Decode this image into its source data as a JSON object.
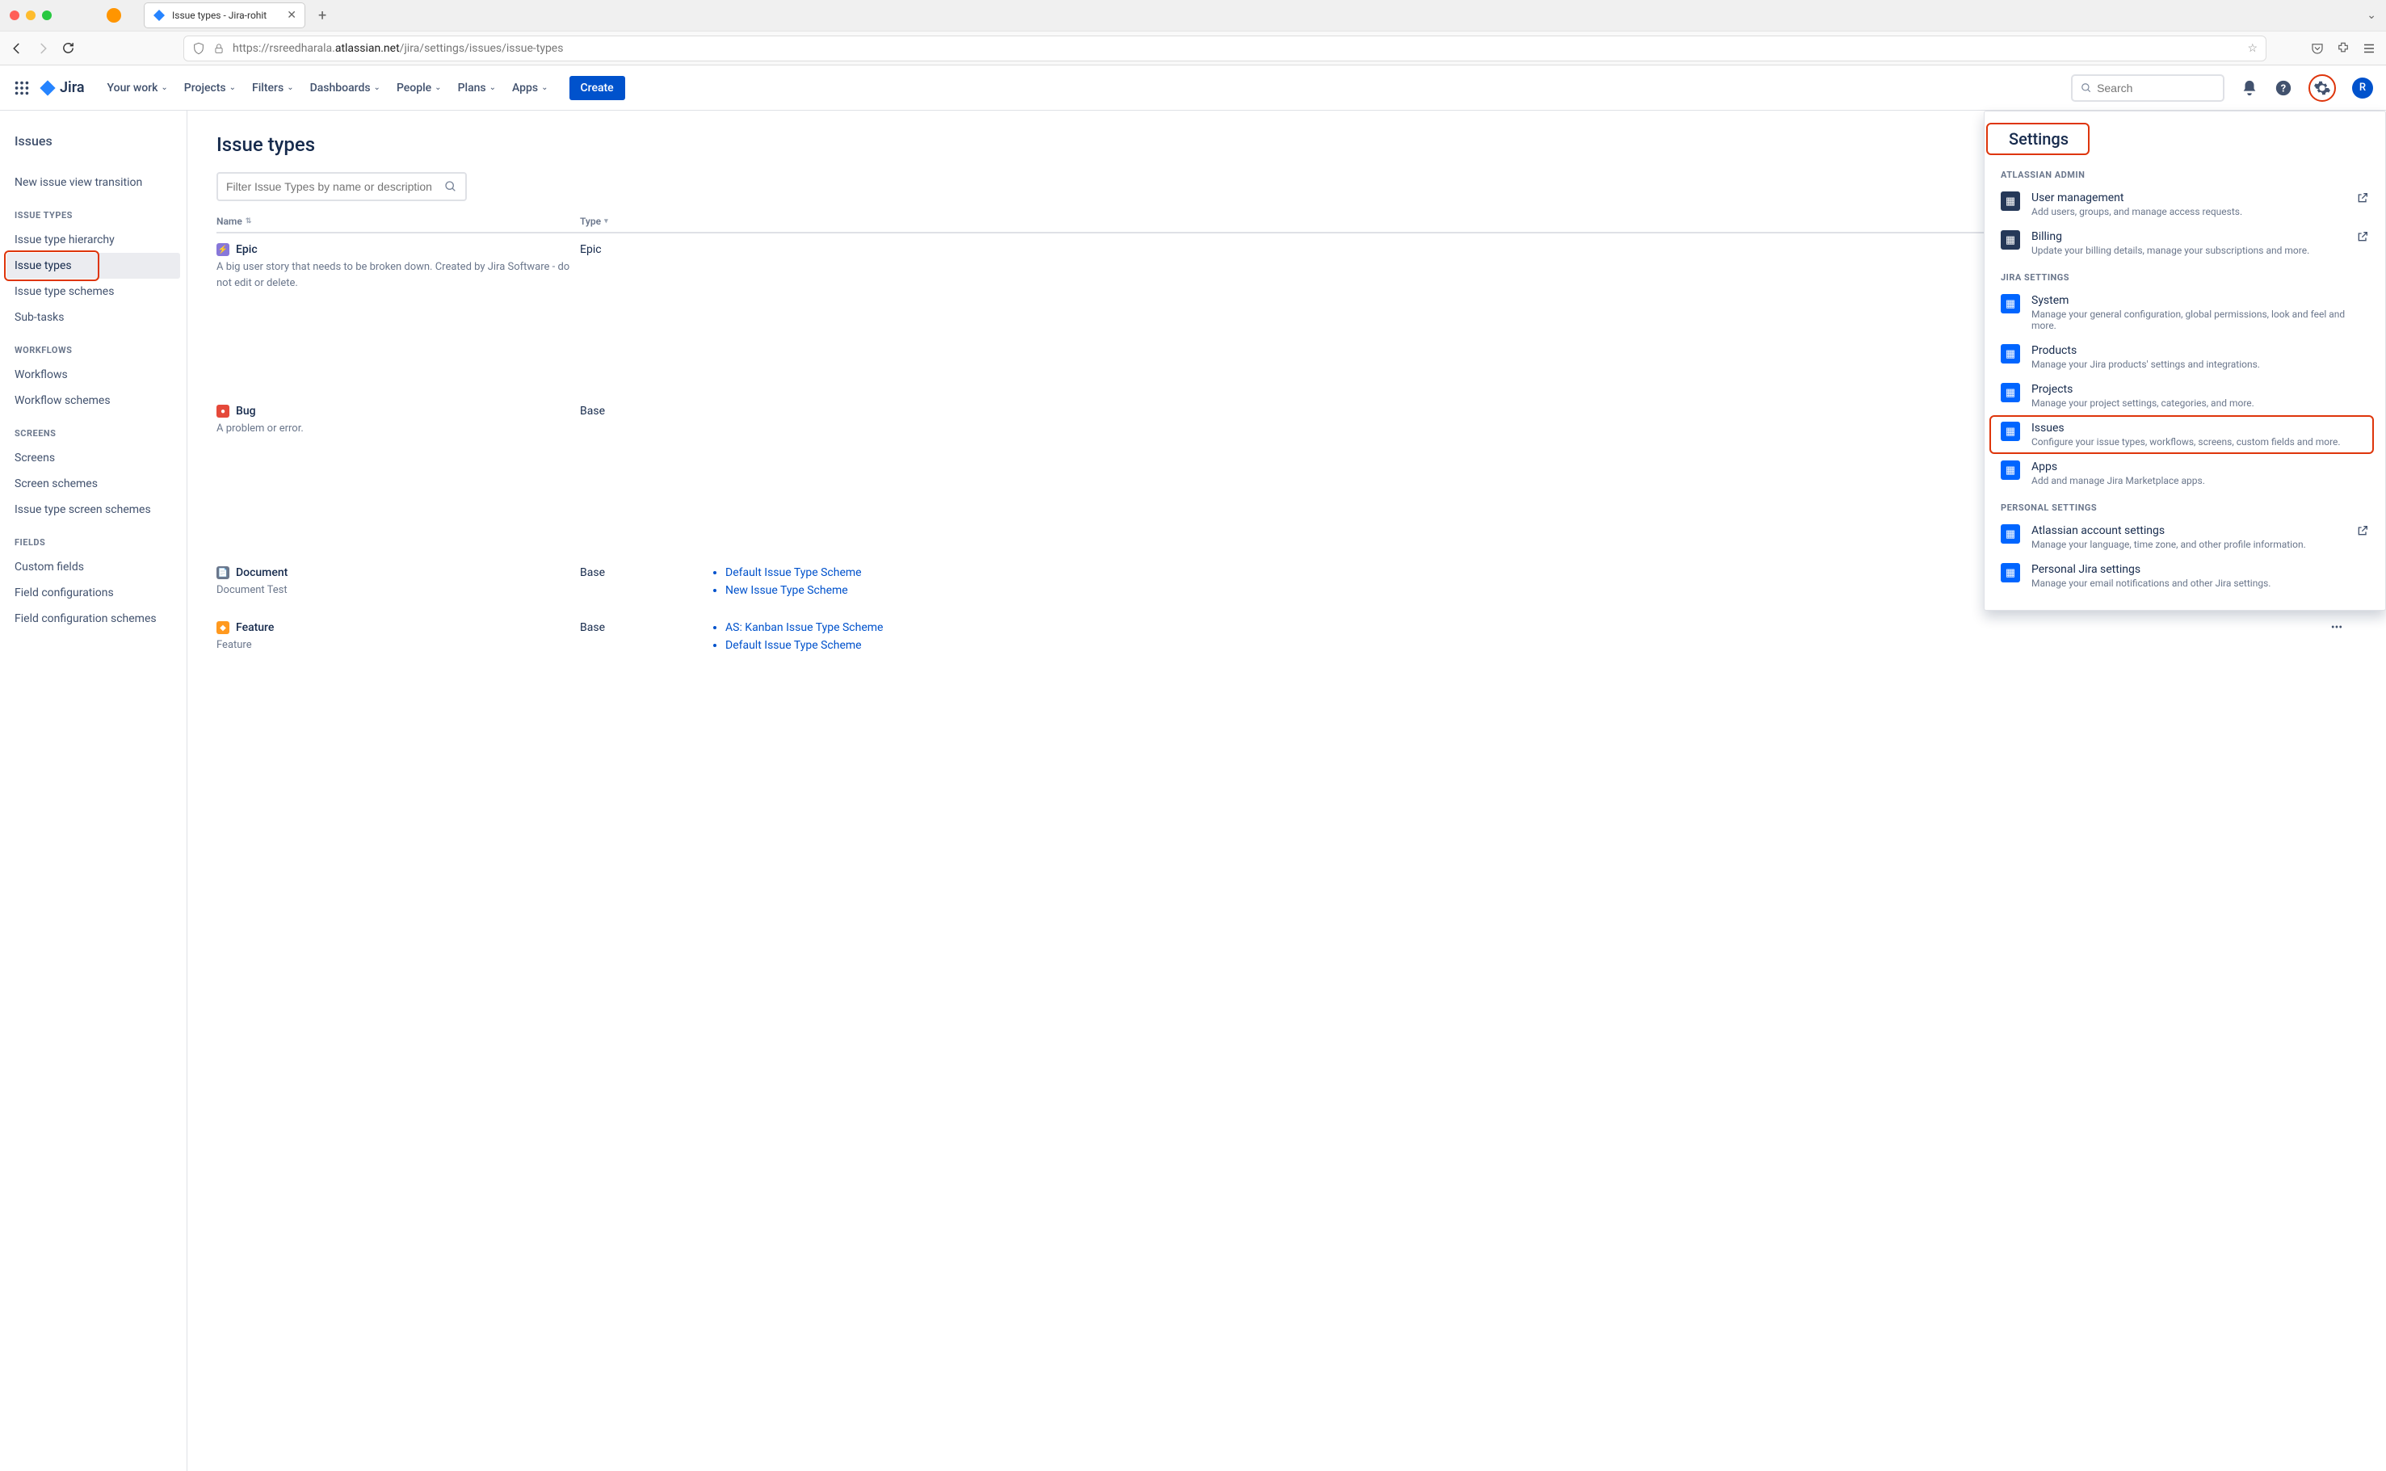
{
  "browser": {
    "tab_title": "Issue types - Jira-rohit",
    "url_prefix": "https://rsreedharala.",
    "url_domain": "atlassian.net",
    "url_path": "/jira/settings/issues/issue-types"
  },
  "nav": {
    "logo_text": "Jira",
    "items": [
      "Your work",
      "Projects",
      "Filters",
      "Dashboards",
      "People",
      "Plans",
      "Apps"
    ],
    "create_label": "Create",
    "search_placeholder": "Search",
    "avatar_letter": "R"
  },
  "sidebar": {
    "title": "Issues",
    "item_transition": "New issue view transition",
    "sections": [
      {
        "heading": "ISSUE TYPES",
        "items": [
          "Issue type hierarchy",
          "Issue types",
          "Issue type schemes",
          "Sub-tasks"
        ]
      },
      {
        "heading": "WORKFLOWS",
        "items": [
          "Workflows",
          "Workflow schemes"
        ]
      },
      {
        "heading": "SCREENS",
        "items": [
          "Screens",
          "Screen schemes",
          "Issue type screen schemes"
        ]
      },
      {
        "heading": "FIELDS",
        "items": [
          "Custom fields",
          "Field configurations",
          "Field configuration schemes"
        ]
      }
    ]
  },
  "main": {
    "title": "Issue types",
    "filter_placeholder": "Filter Issue Types by name or description",
    "columns": {
      "name": "Name",
      "type": "Type"
    },
    "rows": [
      {
        "icon_color": "#8777D9",
        "icon_glyph": "⚡",
        "name": "Epic",
        "desc": "A big user story that needs to be broken down. Created by Jira Software - do not edit or delete.",
        "type": "Epic",
        "schemes": [],
        "actions": false
      },
      {
        "icon_color": "#E5493A",
        "icon_glyph": "●",
        "name": "Bug",
        "desc": "A problem or error.",
        "type": "Base",
        "schemes": [],
        "actions": false
      },
      {
        "icon_color": "#6B778C",
        "icon_glyph": "📄",
        "name": "Document",
        "desc": "Document Test",
        "type": "Base",
        "schemes": [
          "Default Issue Type Scheme",
          "New Issue Type Scheme"
        ],
        "actions": true
      },
      {
        "icon_color": "#FF991F",
        "icon_glyph": "◆",
        "name": "Feature",
        "desc": "Feature",
        "type": "Base",
        "schemes": [
          "AS: Kanban Issue Type Scheme",
          "Default Issue Type Scheme"
        ],
        "actions": true
      }
    ]
  },
  "popover": {
    "title": "Settings",
    "help_icon": "?",
    "sections": [
      {
        "heading": "ATLASSIAN ADMIN",
        "items": [
          {
            "icon_bg": "#253858",
            "title": "User management",
            "desc": "Add users, groups, and manage access requests.",
            "external": true
          },
          {
            "icon_bg": "#253858",
            "title": "Billing",
            "desc": "Update your billing details, manage your subscriptions and more.",
            "external": true
          }
        ]
      },
      {
        "heading": "JIRA SETTINGS",
        "items": [
          {
            "icon_bg": "#0065FF",
            "title": "System",
            "desc": "Manage your general configuration, global permissions, look and feel and more.",
            "external": false
          },
          {
            "icon_bg": "#0065FF",
            "title": "Products",
            "desc": "Manage your Jira products' settings and integrations.",
            "external": false
          },
          {
            "icon_bg": "#0065FF",
            "title": "Projects",
            "desc": "Manage your project settings, categories, and more.",
            "external": false
          },
          {
            "icon_bg": "#0065FF",
            "title": "Issues",
            "desc": "Configure your issue types, workflows, screens, custom fields and more.",
            "external": false,
            "highlight": true
          },
          {
            "icon_bg": "#0065FF",
            "title": "Apps",
            "desc": "Add and manage Jira Marketplace apps.",
            "external": false
          }
        ]
      },
      {
        "heading": "PERSONAL SETTINGS",
        "items": [
          {
            "icon_bg": "#0065FF",
            "title": "Atlassian account settings",
            "desc": "Manage your language, time zone, and other profile information.",
            "external": true
          },
          {
            "icon_bg": "#0065FF",
            "title": "Personal Jira settings",
            "desc": "Manage your email notifications and other Jira settings.",
            "external": false
          }
        ]
      }
    ]
  }
}
